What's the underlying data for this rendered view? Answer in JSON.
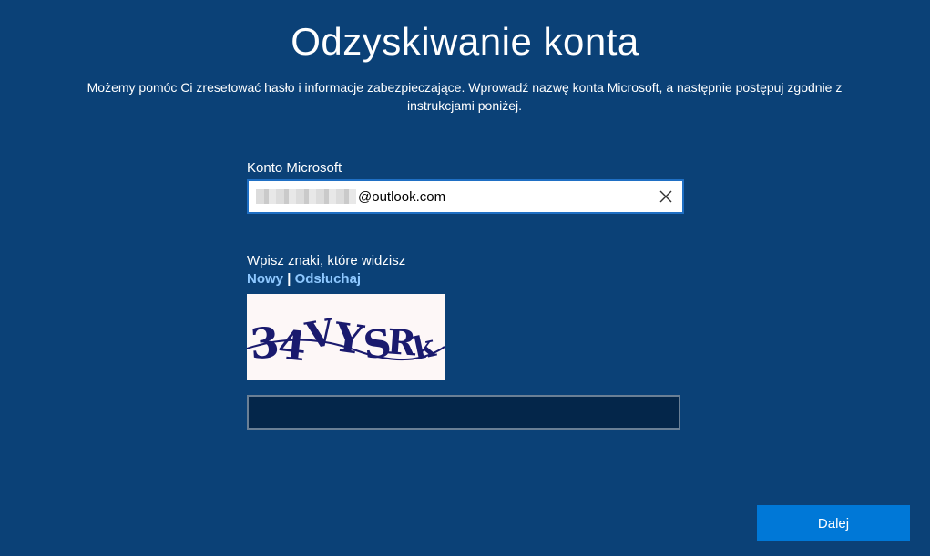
{
  "header": {
    "title": "Odzyskiwanie konta",
    "subtitle": "Możemy pomóc Ci zresetować hasło i informacje zabezpieczające. Wprowadź nazwę konta Microsoft, a następnie postępuj zgodnie z instrukcjami poniżej."
  },
  "account": {
    "label": "Konto Microsoft",
    "value_visible_suffix": "@outlook.com",
    "clear_icon": "close-icon"
  },
  "captcha": {
    "label": "Wpisz znaki, które widzisz",
    "new_link": "Nowy",
    "separator": "|",
    "listen_link": "Odsłuchaj",
    "image_text": "34VYSRk",
    "input_value": ""
  },
  "actions": {
    "next_label": "Dalej"
  },
  "colors": {
    "background": "#0b4177",
    "accent": "#0078d7",
    "link": "#8ec8ff"
  }
}
